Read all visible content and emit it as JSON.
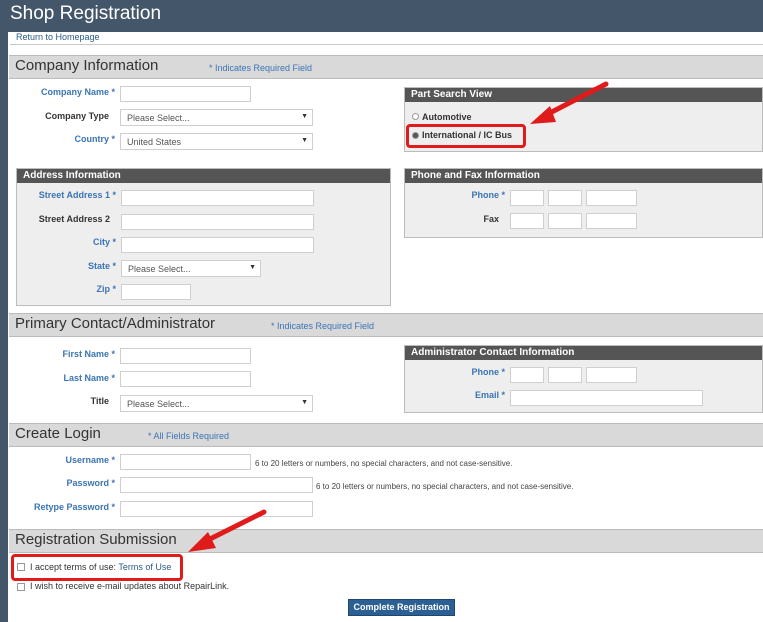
{
  "header": {
    "title": "Shop Registration",
    "home_link": "Return to Homepage"
  },
  "company": {
    "section_title": "Company Information",
    "required_note": "* Indicates Required Field",
    "name_label": "Company Name *",
    "type_label": "Company Type",
    "type_value": "Please Select...",
    "country_label": "Country *",
    "country_value": "United States"
  },
  "part_search": {
    "title": "Part Search View",
    "option_automotive": "Automotive",
    "option_international": "International / IC Bus"
  },
  "address": {
    "title": "Address Information",
    "street1_label": "Street Address 1 *",
    "street2_label": "Street Address 2",
    "city_label": "City *",
    "state_label": "State *",
    "state_value": "Please Select...",
    "zip_label": "Zip *"
  },
  "phone_fax": {
    "title": "Phone and Fax Information",
    "phone_label": "Phone *",
    "fax_label": "Fax"
  },
  "contact": {
    "section_title": "Primary Contact/Administrator",
    "required_note": "* Indicates Required Field",
    "first_label": "First Name *",
    "last_label": "Last Name *",
    "title_label": "Title",
    "title_value": "Please Select..."
  },
  "admin_contact": {
    "title": "Administrator Contact Information",
    "phone_label": "Phone *",
    "email_label": "Email *"
  },
  "login": {
    "section_title": "Create Login",
    "required_note": "* All Fields Required",
    "username_label": "Username *",
    "username_hint": "6 to 20 letters or numbers, no special characters, and not case-sensitive.",
    "password_label": "Password *",
    "password_hint": "6 to 20 letters or numbers, no special characters, and not case-sensitive.",
    "retype_label": "Retype Password *"
  },
  "submission": {
    "section_title": "Registration Submission",
    "terms_text": "I accept terms of use:",
    "terms_link": "Terms of Use",
    "updates_text": "I wish to receive e-mail updates about RepairLink.",
    "submit_label": "Complete Registration"
  },
  "colors": {
    "header": "#44576a",
    "accent_blue": "#3b74b5",
    "annotation_red": "#e01b1b",
    "button": "#2c5f93"
  }
}
